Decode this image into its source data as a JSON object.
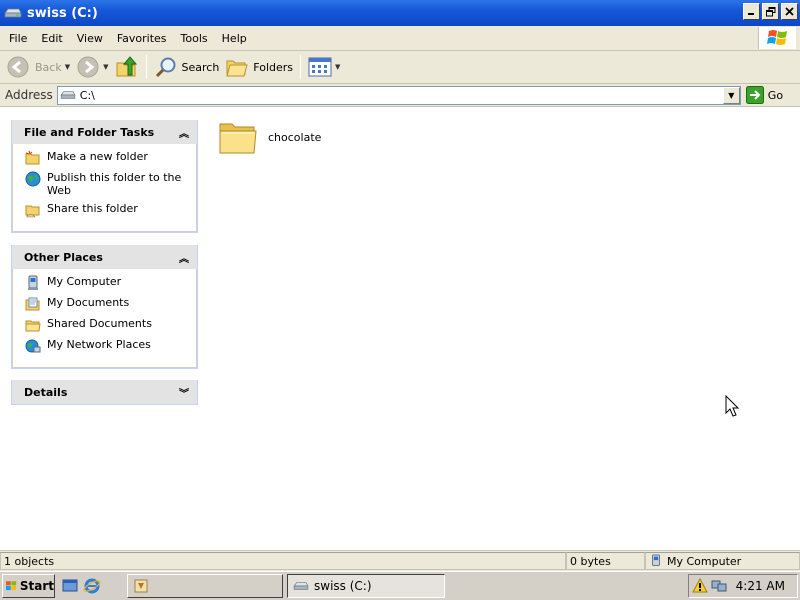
{
  "window": {
    "title": "swiss (C:)"
  },
  "menu": [
    "File",
    "Edit",
    "View",
    "Favorites",
    "Tools",
    "Help"
  ],
  "toolbar": {
    "back": "Back",
    "search": "Search",
    "folders": "Folders"
  },
  "address": {
    "label": "Address",
    "value": "C:\\",
    "go": "Go"
  },
  "panels": {
    "file_tasks": {
      "title": "File and Folder Tasks",
      "items": [
        {
          "label": "Make a new folder",
          "icon": "new-folder-icon"
        },
        {
          "label": "Publish this folder to the Web",
          "icon": "globe-publish-icon"
        },
        {
          "label": "Share this folder",
          "icon": "share-folder-icon"
        }
      ]
    },
    "other_places": {
      "title": "Other Places",
      "items": [
        {
          "label": "My Computer",
          "icon": "my-computer-icon"
        },
        {
          "label": "My Documents",
          "icon": "my-documents-icon"
        },
        {
          "label": "Shared Documents",
          "icon": "shared-documents-icon"
        },
        {
          "label": "My Network Places",
          "icon": "network-places-icon"
        }
      ]
    },
    "details": {
      "title": "Details"
    }
  },
  "content": {
    "folders": [
      {
        "name": "chocolate"
      }
    ]
  },
  "status": {
    "objects": "1 objects",
    "size": "0 bytes",
    "location": "My Computer"
  },
  "taskbar": {
    "start": "Start",
    "window": "swiss (C:)",
    "clock": "4:21 AM"
  }
}
